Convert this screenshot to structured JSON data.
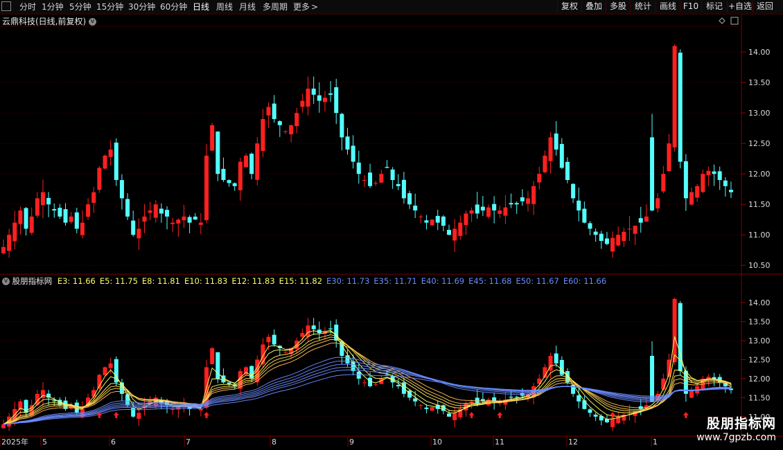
{
  "toolbar": {
    "periods": [
      "分时",
      "1分钟",
      "5分钟",
      "15分钟",
      "30分钟",
      "60分钟",
      "日线",
      "周线",
      "月线",
      "多周期",
      "更多"
    ],
    "active": "日线",
    "right_buttons": [
      "复权",
      "叠加",
      "多股",
      "统计",
      "画线",
      "F10",
      "标记",
      "+自选",
      "返回"
    ]
  },
  "pane1": {
    "title": "云鼎科技(日线,前复权)",
    "yticks": [
      "14.00",
      "13.50",
      "13.00",
      "12.50",
      "12.00",
      "11.50",
      "11.00",
      "10.50"
    ]
  },
  "pane2": {
    "title": "股朋指标网",
    "legend": [
      {
        "label": "E3: 11.66",
        "color": "#ffff66"
      },
      {
        "label": "E5: 11.75",
        "color": "#ffff66"
      },
      {
        "label": "E8: 11.81",
        "color": "#ffff66"
      },
      {
        "label": "E10: 11.83",
        "color": "#ffff66"
      },
      {
        "label": "E12: 11.83",
        "color": "#ffff66"
      },
      {
        "label": "E15: 11.82",
        "color": "#ffff66"
      },
      {
        "label": "E30: 11.73",
        "color": "#6a8cff"
      },
      {
        "label": "E35: 11.71",
        "color": "#6a8cff"
      },
      {
        "label": "E40: 11.69",
        "color": "#6a8cff"
      },
      {
        "label": "E45: 11.68",
        "color": "#6a8cff"
      },
      {
        "label": "E50: 11.67",
        "color": "#6a8cff"
      },
      {
        "label": "E60: 11.66",
        "color": "#6a8cff"
      }
    ],
    "yticks": [
      "14.00",
      "13.50",
      "13.00",
      "12.50",
      "12.00",
      "11.50",
      "11.00"
    ]
  },
  "xaxis": {
    "labels": [
      "2025年",
      "5",
      "6",
      "7",
      "8",
      "9",
      "10",
      "11",
      "12",
      "1"
    ]
  },
  "watermark": {
    "line1": "股朋指标网",
    "line2": "www.7gpzb.com"
  },
  "chart_data": {
    "type": "candlestick",
    "title": "云鼎科技(日线,前复权)",
    "x_labels": [
      "2025年",
      "5",
      "6",
      "7",
      "8",
      "9",
      "10",
      "11",
      "12",
      "1"
    ],
    "ylim": [
      10.4,
      14.4
    ],
    "closes": [
      10.8,
      11.0,
      11.2,
      11.4,
      11.1,
      11.3,
      11.6,
      11.7,
      11.5,
      11.4,
      11.3,
      11.2,
      11.3,
      11.1,
      11.2,
      11.5,
      11.7,
      12.1,
      12.3,
      12.4,
      11.9,
      11.6,
      11.3,
      11.0,
      11.1,
      11.3,
      11.4,
      11.5,
      11.35,
      11.3,
      11.2,
      11.25,
      11.3,
      11.2,
      11.25,
      11.2,
      12.3,
      12.8,
      12.0,
      11.9,
      11.85,
      11.8,
      12.2,
      12.3,
      12.0,
      12.5,
      12.9,
      13.1,
      12.9,
      12.8,
      12.7,
      12.8,
      13.0,
      13.2,
      13.4,
      13.3,
      13.2,
      13.25,
      13.3,
      13.0,
      12.6,
      12.4,
      12.2,
      12.0,
      11.9,
      11.8,
      11.85,
      12.0,
      12.1,
      11.9,
      11.8,
      11.6,
      11.5,
      11.4,
      11.3,
      11.2,
      11.25,
      11.2,
      11.15,
      11.0,
      11.1,
      11.2,
      11.35,
      11.4,
      11.35,
      11.4,
      11.45,
      11.4,
      11.4,
      11.45,
      11.5,
      11.5,
      11.55,
      11.6,
      11.8,
      12.0,
      12.3,
      12.6,
      12.4,
      12.1,
      11.9,
      11.6,
      11.4,
      11.2,
      11.1,
      11.0,
      10.9,
      10.85,
      10.95,
      11.0,
      11.05,
      11.1,
      11.15,
      11.2,
      11.3,
      11.4,
      11.6,
      12.0,
      12.5,
      14.1,
      12.2,
      11.6,
      11.7,
      11.8,
      12.0,
      12.05,
      12.0,
      11.9,
      11.8,
      11.7
    ],
    "ma_lines": {
      "E3": 11.66,
      "E5": 11.75,
      "E8": 11.81,
      "E10": 11.83,
      "E12": 11.83,
      "E15": 11.82,
      "E30": 11.73,
      "E35": 11.71,
      "E40": 11.69,
      "E45": 11.68,
      "E50": 11.67,
      "E60": 11.66
    },
    "grid": true
  }
}
